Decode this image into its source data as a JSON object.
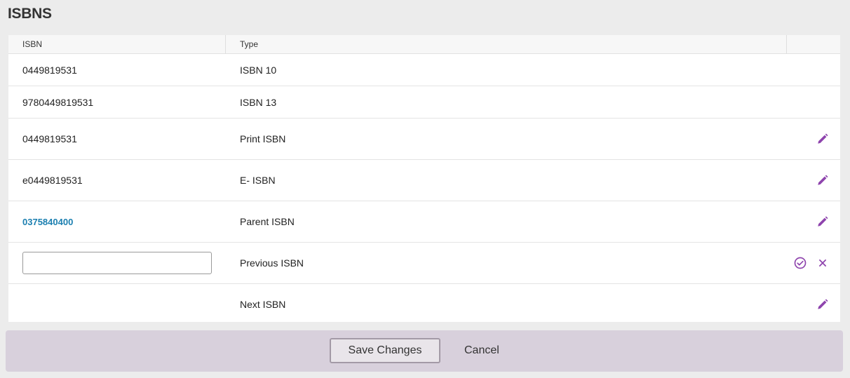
{
  "page": {
    "title": "ISBNS"
  },
  "table": {
    "headers": {
      "isbn": "ISBN",
      "type": "Type"
    },
    "rows": [
      {
        "isbn": "0449819531",
        "type": "ISBN 10"
      },
      {
        "isbn": "9780449819531",
        "type": "ISBN 13"
      },
      {
        "isbn": "0449819531",
        "type": "Print ISBN"
      },
      {
        "isbn": "e0449819531",
        "type": "E- ISBN"
      },
      {
        "isbn": "0375840400",
        "type": "Parent ISBN"
      },
      {
        "isbn_input_value": "",
        "type": "Previous ISBN"
      },
      {
        "isbn": "",
        "type": "Next ISBN"
      }
    ]
  },
  "icons": {
    "edit": "pencil-icon",
    "confirm": "check-circle-icon",
    "cancel": "close-icon",
    "accent_color": "#8e44ad"
  },
  "footer": {
    "save_label": "Save Changes",
    "cancel_label": "Cancel"
  }
}
